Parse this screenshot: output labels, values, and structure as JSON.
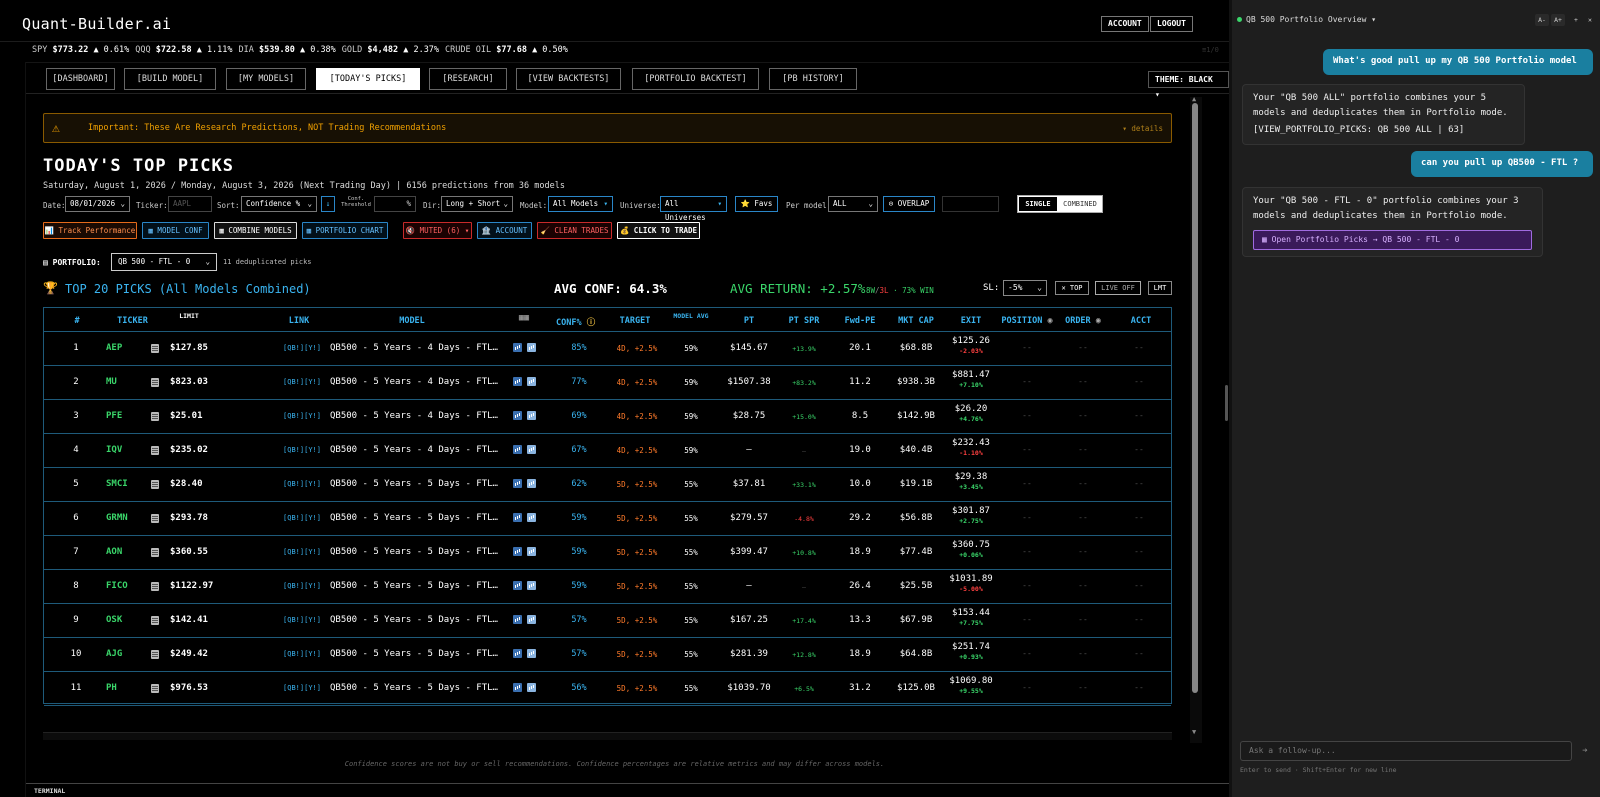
{
  "header": {
    "logo": "Quant-Builder.ai",
    "account_label": "ACCOUNT",
    "logout_label": "LOGOUT"
  },
  "ticker_tape": [
    {
      "sym": "SPY",
      "price": "$773.22",
      "chg": "▲ 0.61%"
    },
    {
      "sym": "QQQ",
      "price": "$722.58",
      "chg": "▲ 1.11%"
    },
    {
      "sym": "DIA",
      "price": "$539.80",
      "chg": "▲ 0.38%"
    },
    {
      "sym": "GOLD",
      "price": "$4,482",
      "chg": "▲ 2.37%"
    },
    {
      "sym": "CRUDE OIL",
      "price": "$77.68",
      "chg": "▲ 0.50%"
    }
  ],
  "ticker_right": "≡1/0",
  "nav": {
    "tabs": [
      "[DASHBOARD]",
      "[BUILD MODEL]",
      "[MY MODELS]",
      "[TODAY'S PICKS]",
      "[RESEARCH]",
      "[VIEW BACKTESTS]",
      "[PORTFOLIO BACKTEST]",
      "[PB HISTORY]"
    ],
    "active_index": 3,
    "theme_label": "THEME: BLACK ▾"
  },
  "warning": {
    "text": "Important: These Are Research Predictions, NOT Trading Recommendations",
    "details": "▾ details"
  },
  "page": {
    "title": "TODAY'S TOP PICKS",
    "subtitle": "Saturday, August 1, 2026 / Monday, August 3, 2026 (Next Trading Day) | 6156 predictions from 36 models"
  },
  "filters": {
    "date_label": "Date:",
    "date_value": "08/01/2026",
    "ticker_label": "Ticker:",
    "ticker_placeholder": "AAPL",
    "sort_label": "Sort:",
    "sort_value": "Confidence %",
    "sort_dir": "↓",
    "conf_label": "Conf. Threshold",
    "conf_unit": "%",
    "dir_label": "Dir:",
    "dir_value": "Long + Short",
    "model_label": "Model:",
    "model_value": "All Models",
    "universe_label": "Universe:",
    "universe_value": "All Universes",
    "favs_label": "⭐ Favs",
    "per_model_label": "Per model:",
    "per_model_value": "ALL",
    "overlap_label": "⊙ OVERLAP",
    "single_label": "SINGLE",
    "combined_label": "COMBINED"
  },
  "actions": {
    "track": "📊 Track Performance",
    "model_conf": "▦ MODEL CONF",
    "combine": "▦ COMBINE MODELS",
    "portfolio_chart": "▦ PORTFOLIO CHART",
    "muted": "🔇 MUTED (6) ▾",
    "account": "🏦 ACCOUNT",
    "clean": "🧹 CLEAN TRADES",
    "trade": "💰 CLICK TO TRADE"
  },
  "portfolio": {
    "label": "PORTFOLIO:",
    "value": "QB 500 - FTL - 0",
    "count": "11 deduplicated picks"
  },
  "summary": {
    "title": "TOP 20 PICKS (All Models Combined)",
    "avg_conf": "AVG CONF: 64.3%",
    "avg_return": "AVG RETURN: +2.57%",
    "wins": "8W",
    "losses": "3L",
    "win_rate": "· 73% WIN",
    "sl_label": "SL:",
    "sl_value": "-5%",
    "top_label": "✕ TOP",
    "live_label": "LIVE OFF",
    "lmt_label": "LMT"
  },
  "table": {
    "headers": {
      "num": "#",
      "ticker": "TICKER",
      "limit": "LIMIT",
      "link": "LINK",
      "model": "MODEL",
      "conf": "CONF%",
      "target": "TARGET",
      "model_avg": "MODEL AVG",
      "pt": "PT",
      "pt_spr": "PT SPR",
      "fwd_pe": "Fwd-PE",
      "mkt_cap": "MKT CAP",
      "exit": "EXIT",
      "position": "POSITION",
      "order": "ORDER",
      "acct": "ACCT"
    },
    "link_text": "[QB!][Y!]",
    "dash": "--",
    "rows": [
      {
        "n": "1",
        "t": "AEP",
        "lim": "$127.85",
        "model": "QB500 - 5 Years - 4 Days - FTL…",
        "conf": "85%",
        "tgt": "4D, +2.5%",
        "mavg": "59%",
        "pt": "$145.67",
        "spr": "+13.9%",
        "spr_c": "#3ad66a",
        "pe": "20.1",
        "cap": "$68.8B",
        "exit": "$125.26",
        "exc": "-2.03%",
        "exc_c": "#ff4040"
      },
      {
        "n": "2",
        "t": "MU",
        "lim": "$823.03",
        "model": "QB500 - 5 Years - 4 Days - FTL…",
        "conf": "77%",
        "tgt": "4D, +2.5%",
        "mavg": "59%",
        "pt": "$1507.38",
        "spr": "+83.2%",
        "spr_c": "#3ad66a",
        "pe": "11.2",
        "cap": "$938.3B",
        "exit": "$881.47",
        "exc": "+7.10%",
        "exc_c": "#3ad66a"
      },
      {
        "n": "3",
        "t": "PFE",
        "lim": "$25.01",
        "model": "QB500 - 5 Years - 4 Days - FTL…",
        "conf": "69%",
        "tgt": "4D, +2.5%",
        "mavg": "59%",
        "pt": "$28.75",
        "spr": "+15.0%",
        "spr_c": "#3ad66a",
        "pe": "8.5",
        "cap": "$142.9B",
        "exit": "$26.20",
        "exc": "+4.76%",
        "exc_c": "#3ad66a"
      },
      {
        "n": "4",
        "t": "IQV",
        "lim": "$235.02",
        "model": "QB500 - 5 Years - 4 Days - FTL…",
        "conf": "67%",
        "tgt": "4D, +2.5%",
        "mavg": "59%",
        "pt": "—",
        "spr": "—",
        "spr_c": "#555",
        "pe": "19.0",
        "cap": "$40.4B",
        "exit": "$232.43",
        "exc": "-1.10%",
        "exc_c": "#ff4040"
      },
      {
        "n": "5",
        "t": "SMCI",
        "lim": "$28.40",
        "model": "QB500 - 5 Years - 5 Days - FTL…",
        "conf": "62%",
        "tgt": "5D, +2.5%",
        "mavg": "55%",
        "pt": "$37.81",
        "spr": "+33.1%",
        "spr_c": "#3ad66a",
        "pe": "10.0",
        "cap": "$19.1B",
        "exit": "$29.38",
        "exc": "+3.45%",
        "exc_c": "#3ad66a"
      },
      {
        "n": "6",
        "t": "GRMN",
        "lim": "$293.78",
        "model": "QB500 - 5 Years - 5 Days - FTL…",
        "conf": "59%",
        "tgt": "5D, +2.5%",
        "mavg": "55%",
        "pt": "$279.57",
        "spr": "-4.8%",
        "spr_c": "#ff4040",
        "pe": "29.2",
        "cap": "$56.8B",
        "exit": "$301.87",
        "exc": "+2.75%",
        "exc_c": "#3ad66a"
      },
      {
        "n": "7",
        "t": "AON",
        "lim": "$360.55",
        "model": "QB500 - 5 Years - 5 Days - FTL…",
        "conf": "59%",
        "tgt": "5D, +2.5%",
        "mavg": "55%",
        "pt": "$399.47",
        "spr": "+10.8%",
        "spr_c": "#3ad66a",
        "pe": "18.9",
        "cap": "$77.4B",
        "exit": "$360.75",
        "exc": "+0.06%",
        "exc_c": "#3ad66a"
      },
      {
        "n": "8",
        "t": "FICO",
        "lim": "$1122.97",
        "model": "QB500 - 5 Years - 5 Days - FTL…",
        "conf": "59%",
        "tgt": "5D, +2.5%",
        "mavg": "55%",
        "pt": "—",
        "spr": "—",
        "spr_c": "#555",
        "pe": "26.4",
        "cap": "$25.5B",
        "exit": "$1031.89",
        "exc": "-5.00%",
        "exc_c": "#ff4040"
      },
      {
        "n": "9",
        "t": "OSK",
        "lim": "$142.41",
        "model": "QB500 - 5 Years - 5 Days - FTL…",
        "conf": "57%",
        "tgt": "5D, +2.5%",
        "mavg": "55%",
        "pt": "$167.25",
        "spr": "+17.4%",
        "spr_c": "#3ad66a",
        "pe": "13.3",
        "cap": "$67.9B",
        "exit": "$153.44",
        "exc": "+7.75%",
        "exc_c": "#3ad66a"
      },
      {
        "n": "10",
        "t": "AJG",
        "lim": "$249.42",
        "model": "QB500 - 5 Years - 5 Days - FTL…",
        "conf": "57%",
        "tgt": "5D, +2.5%",
        "mavg": "55%",
        "pt": "$281.39",
        "spr": "+12.8%",
        "spr_c": "#3ad66a",
        "pe": "18.9",
        "cap": "$64.8B",
        "exit": "$251.74",
        "exc": "+0.93%",
        "exc_c": "#3ad66a"
      },
      {
        "n": "11",
        "t": "PH",
        "lim": "$976.53",
        "model": "QB500 - 5 Years - 5 Days - FTL…",
        "conf": "56%",
        "tgt": "5D, +2.5%",
        "mavg": "55%",
        "pt": "$1039.70",
        "spr": "+6.5%",
        "spr_c": "#3ad66a",
        "pe": "31.2",
        "cap": "$125.0B",
        "exit": "$1069.80",
        "exc": "+9.55%",
        "exc_c": "#3ad66a"
      }
    ]
  },
  "footnote": "Confidence scores are not buy or sell recommendations. Confidence percentages are relative metrics and may differ across models.",
  "terminal_label": "TERMINAL",
  "chat": {
    "title": "QB 500 Portfolio Overview",
    "title_caret": "▾",
    "btn_aminus": "A-",
    "btn_aplus": "A+",
    "btn_plus": "+",
    "btn_close": "✕",
    "messages": [
      {
        "role": "user",
        "text": "What's good pull up my QB 500 Portfolio model"
      },
      {
        "role": "assistant",
        "lines": [
          "Your \"QB 500 ALL\" portfolio combines your 5",
          "models and deduplicates them in Portfolio mode.",
          "[VIEW_PORTFOLIO_PICKS: QB 500 ALL | 63]"
        ]
      },
      {
        "role": "user",
        "text": "can you pull up QB500 - FTL ?"
      },
      {
        "role": "assistant",
        "lines": [
          "Your \"QB 500 - FTL - 0\" portfolio combines your 3",
          "models and deduplicates them in Portfolio mode."
        ],
        "button": "▦ Open Portfolio Picks → QB 500 - FTL - 0"
      }
    ],
    "input_placeholder": "Ask a follow-up...",
    "send_icon": "➔",
    "hint": "Enter to send · Shift+Enter for new line"
  }
}
